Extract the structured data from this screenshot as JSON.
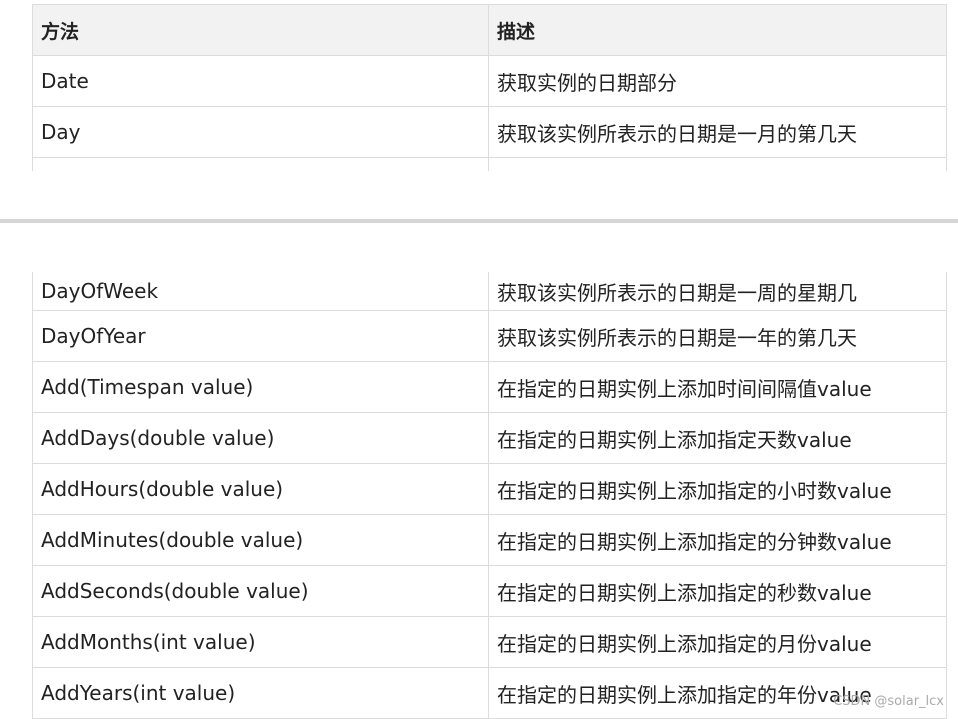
{
  "header": {
    "method": "方法",
    "description": "描述"
  },
  "top_rows": [
    {
      "method": "Date",
      "description": "获取实例的日期部分"
    },
    {
      "method": "Day",
      "description": "获取该实例所表示的日期是一月的第几天"
    }
  ],
  "bottom_rows": [
    {
      "method": "DayOfWeek",
      "description": "获取该实例所表示的日期是一周的星期几"
    },
    {
      "method": "DayOfYear",
      "description": "获取该实例所表示的日期是一年的第几天"
    },
    {
      "method": "Add(Timespan value)",
      "description": "在指定的日期实例上添加时间间隔值value"
    },
    {
      "method": "AddDays(double value)",
      "description": "在指定的日期实例上添加指定天数value"
    },
    {
      "method": "AddHours(double value)",
      "description": "在指定的日期实例上添加指定的小时数value"
    },
    {
      "method": "AddMinutes(double value)",
      "description": "在指定的日期实例上添加指定的分钟数value"
    },
    {
      "method": "AddSeconds(double value)",
      "description": "在指定的日期实例上添加指定的秒数value"
    },
    {
      "method": "AddMonths(int value)",
      "description": "在指定的日期实例上添加指定的月份value"
    },
    {
      "method": "AddYears(int value)",
      "description": "在指定的日期实例上添加指定的年份value"
    }
  ],
  "watermark": "CSDN @solar_lcx"
}
